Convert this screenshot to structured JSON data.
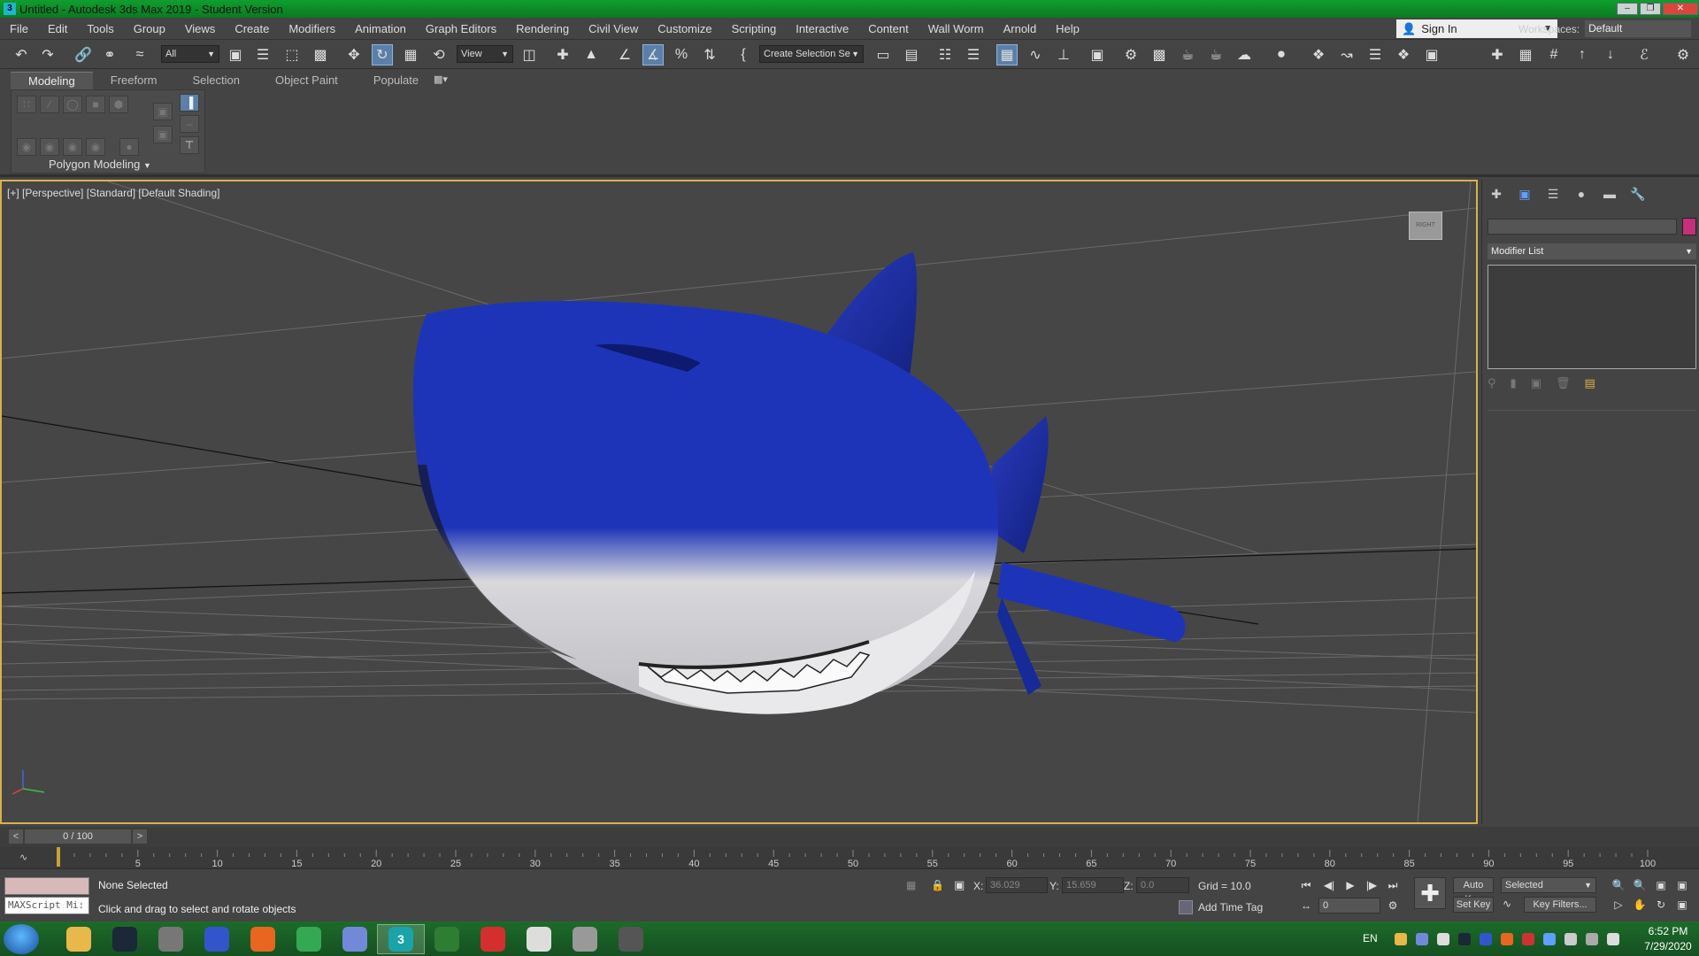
{
  "window": {
    "title": "Untitled - Autodesk 3ds Max 2019 - Student Version",
    "app_icon_glyph": "3"
  },
  "menu": {
    "items": [
      "File",
      "Edit",
      "Tools",
      "Group",
      "Views",
      "Create",
      "Modifiers",
      "Animation",
      "Graph Editors",
      "Rendering",
      "Civil View",
      "Customize",
      "Scripting",
      "Interactive",
      "Content",
      "Wall Worm",
      "Arnold",
      "Help"
    ]
  },
  "account": {
    "sign_in_label": "Sign In",
    "workspaces_label": "Workspaces:",
    "workspace_value": "Default"
  },
  "toolbar": {
    "selection_filter": "All",
    "reference_coord": "View",
    "named_selection": "Create Selection Se"
  },
  "ribbon": {
    "tabs": [
      "Modeling",
      "Freeform",
      "Selection",
      "Object Paint",
      "Populate"
    ],
    "active_tab": "Modeling",
    "panel_label": "Polygon Modeling"
  },
  "viewport": {
    "label": "[+] [Perspective] [Standard] [Default Shading]",
    "viewcube_label": "RIGHT",
    "model_colors": {
      "top": "#1e34b8",
      "belly": "#e8e8ea"
    }
  },
  "command_panel": {
    "modifier_list_label": "Modifier List",
    "object_color": "#c4307a"
  },
  "timeline": {
    "frame_display": "0 / 100",
    "prev": "<",
    "next": ">",
    "ticks": [
      5,
      10,
      15,
      20,
      25,
      30,
      35,
      40,
      45,
      50,
      55,
      60,
      65,
      70,
      75,
      80,
      85,
      90,
      95,
      100
    ]
  },
  "status": {
    "maxscript_placeholder": "MAXScript Mi:",
    "selection": "None Selected",
    "prompt": "Click and drag to select and rotate objects",
    "x_label": "X:",
    "x_value": "36.029",
    "y_label": "Y:",
    "y_value": "15.659",
    "z_label": "Z:",
    "z_value": "0.0",
    "grid": "Grid = 10.0",
    "add_time_tag": "Add Time Tag",
    "frame_value": "0",
    "auto_key": "Auto Key",
    "set_key": "Set Key",
    "key_mode": "Selected",
    "key_filters": "Key Filters..."
  },
  "taskbar": {
    "language": "EN",
    "time": "6:52 PM",
    "date": "7/29/2020",
    "apps": [
      {
        "name": "file-explorer",
        "color": "#e8b84a",
        "glyph": ""
      },
      {
        "name": "steam",
        "color": "#1b2838",
        "glyph": ""
      },
      {
        "name": "wolf-app",
        "color": "#777777",
        "glyph": ""
      },
      {
        "name": "audio-app",
        "color": "#3355cc",
        "glyph": ""
      },
      {
        "name": "firefox",
        "color": "#e8661f",
        "glyph": ""
      },
      {
        "name": "chrome",
        "color": "#34a853",
        "glyph": ""
      },
      {
        "name": "discord",
        "color": "#7289da",
        "glyph": ""
      },
      {
        "name": "3ds-max",
        "color": "#1aa3a8",
        "glyph": "3"
      },
      {
        "name": "spreadsheet",
        "color": "#2e7d32",
        "glyph": ""
      },
      {
        "name": "acrobat",
        "color": "#d32f2f",
        "glyph": ""
      },
      {
        "name": "alien-app",
        "color": "#dddddd",
        "glyph": ""
      },
      {
        "name": "hammer-editor",
        "color": "#999999",
        "glyph": ""
      },
      {
        "name": "video-editor",
        "color": "#555555",
        "glyph": ""
      }
    ]
  }
}
